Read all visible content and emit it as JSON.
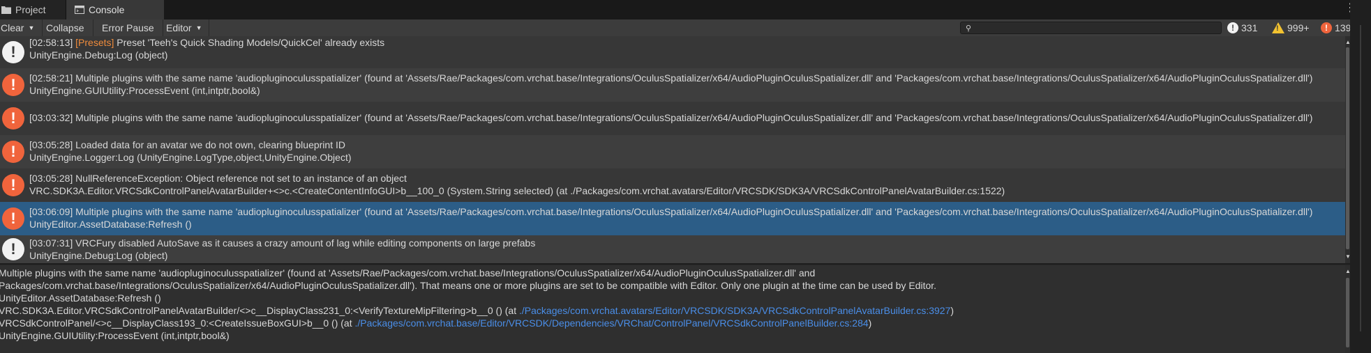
{
  "tabs": {
    "project_label": "Project",
    "console_label": "Console"
  },
  "toolbar": {
    "clear_label": "Clear",
    "collapse_label": "Collapse",
    "error_pause_label": "Error Pause",
    "editor_label": "Editor",
    "search_placeholder": "",
    "info_count": "331",
    "warning_count": "999+",
    "error_count": "139"
  },
  "logs": [
    {
      "level": "info",
      "time": "[02:58:13] ",
      "tag": "[Presets]",
      "message": " Preset 'Teeh's Quick Shading Models/QuickCel' already exists",
      "trace": "UnityEngine.Debug:Log (object)"
    },
    {
      "level": "error",
      "time": "[02:58:21] ",
      "tag": "",
      "message": "Multiple plugins with the same name 'audiopluginoculusspatializer' (found at 'Assets/Rae/Packages/com.vrchat.base/Integrations/OculusSpatializer/x64/AudioPluginOculusSpatializer.dll' and 'Packages/com.vrchat.base/Integrations/OculusSpatializer/x64/AudioPluginOculusSpatializer.dll')",
      "trace": "UnityEngine.GUIUtility:ProcessEvent (int,intptr,bool&)"
    },
    {
      "level": "error",
      "time": "[03:03:32] ",
      "tag": "",
      "message": "Multiple plugins with the same name 'audiopluginoculusspatializer' (found at 'Assets/Rae/Packages/com.vrchat.base/Integrations/OculusSpatializer/x64/AudioPluginOculusSpatializer.dll' and 'Packages/com.vrchat.base/Integrations/OculusSpatializer/x64/AudioPluginOculusSpatializer.dll')",
      "trace": ""
    },
    {
      "level": "error",
      "time": "[03:05:28] ",
      "tag": "",
      "message": "Loaded data for an avatar we do not own, clearing blueprint ID",
      "trace": "UnityEngine.Logger:Log (UnityEngine.LogType,object,UnityEngine.Object)"
    },
    {
      "level": "error",
      "time": "[03:05:28] ",
      "tag": "",
      "message": "NullReferenceException: Object reference not set to an instance of an object",
      "trace": "VRC.SDK3A.Editor.VRCSdkControlPanelAvatarBuilder+<>c.<CreateContentInfoGUI>b__100_0 (System.String selected) (at ./Packages/com.vrchat.avatars/Editor/VRCSDK/SDK3A/VRCSdkControlPanelAvatarBuilder.cs:1522)"
    },
    {
      "level": "error",
      "time": "[03:06:09] ",
      "tag": "",
      "message": "Multiple plugins with the same name 'audiopluginoculusspatializer' (found at 'Assets/Rae/Packages/com.vrchat.base/Integrations/OculusSpatializer/x64/AudioPluginOculusSpatializer.dll' and 'Packages/com.vrchat.base/Integrations/OculusSpatializer/x64/AudioPluginOculusSpatializer.dll')",
      "trace": "UnityEditor.AssetDatabase:Refresh ()"
    },
    {
      "level": "info",
      "time": "[03:07:31] ",
      "tag": "",
      "message": "VRCFury disabled AutoSave as it causes a crazy amount of lag while editing components on large prefabs",
      "trace": "UnityEngine.Debug:Log (object)"
    }
  ],
  "detail": {
    "line1": "Multiple plugins with the same name 'audiopluginoculusspatializer' (found at 'Assets/Rae/Packages/com.vrchat.base/Integrations/OculusSpatializer/x64/AudioPluginOculusSpatializer.dll' and",
    "line2": "Packages/com.vrchat.base/Integrations/OculusSpatializer/x64/AudioPluginOculusSpatializer.dll'). That means one or more plugins are set to be compatible with Editor. Only one plugin at the time can be used by Editor.",
    "line3": "UnityEditor.AssetDatabase:Refresh ()",
    "line4_prefix": "VRC.SDK3A.Editor.VRCSdkControlPanelAvatarBuilder/<>c__DisplayClass231_0:<VerifyTextureMipFiltering>b__0 () (at ",
    "line4_link": "./Packages/com.vrchat.avatars/Editor/VRCSDK/SDK3A/VRCSdkControlPanelAvatarBuilder.cs:3927",
    "line4_suffix": ")",
    "line5_prefix": "VRCSdkControlPanel/<>c__DisplayClass193_0:<CreateIssueBoxGUI>b__0 () (at ",
    "line5_link": "./Packages/com.vrchat.base/Editor/VRCSDK/Dependencies/VRChat/ControlPanel/VRCSdkControlPanelBuilder.cs:284",
    "line5_suffix": ")",
    "line6": "UnityEngine.GUIUtility:ProcessEvent (int,intptr,bool&)"
  },
  "colors": {
    "tag": "#f08c3c",
    "link": "#4a8ee8",
    "selected_row": "#2c5d87",
    "error": "#f0643c",
    "warning": "#f2c230"
  }
}
